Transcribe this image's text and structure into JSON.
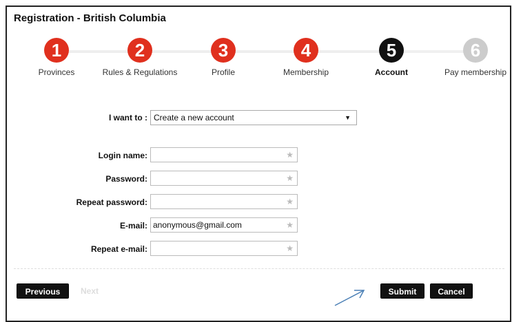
{
  "header": {
    "title": "Registration - British Columbia"
  },
  "colors": {
    "active": "#e0301e",
    "current": "#111111",
    "inactive": "#cccccc"
  },
  "steps": [
    {
      "number": "1",
      "label": "Provinces",
      "state": "done"
    },
    {
      "number": "2",
      "label": "Rules & Regulations",
      "state": "done"
    },
    {
      "number": "3",
      "label": "Profile",
      "state": "done"
    },
    {
      "number": "4",
      "label": "Membership",
      "state": "done"
    },
    {
      "number": "5",
      "label": "Account",
      "state": "current"
    },
    {
      "number": "6",
      "label": "Pay membership",
      "state": "pending"
    }
  ],
  "form": {
    "action_label": "I want to :",
    "action_value": "Create a new account",
    "login_label": "Login name:",
    "login_value": "",
    "password_label": "Password:",
    "password_value": "",
    "repeat_password_label": "Repeat password:",
    "repeat_password_value": "",
    "email_label": "E-mail:",
    "email_value": "anonymous@gmail.com",
    "repeat_email_label": "Repeat e-mail:",
    "repeat_email_value": "",
    "required_mark": "★"
  },
  "footer": {
    "previous_label": "Previous",
    "next_label": "Next",
    "submit_label": "Submit",
    "cancel_label": "Cancel"
  }
}
